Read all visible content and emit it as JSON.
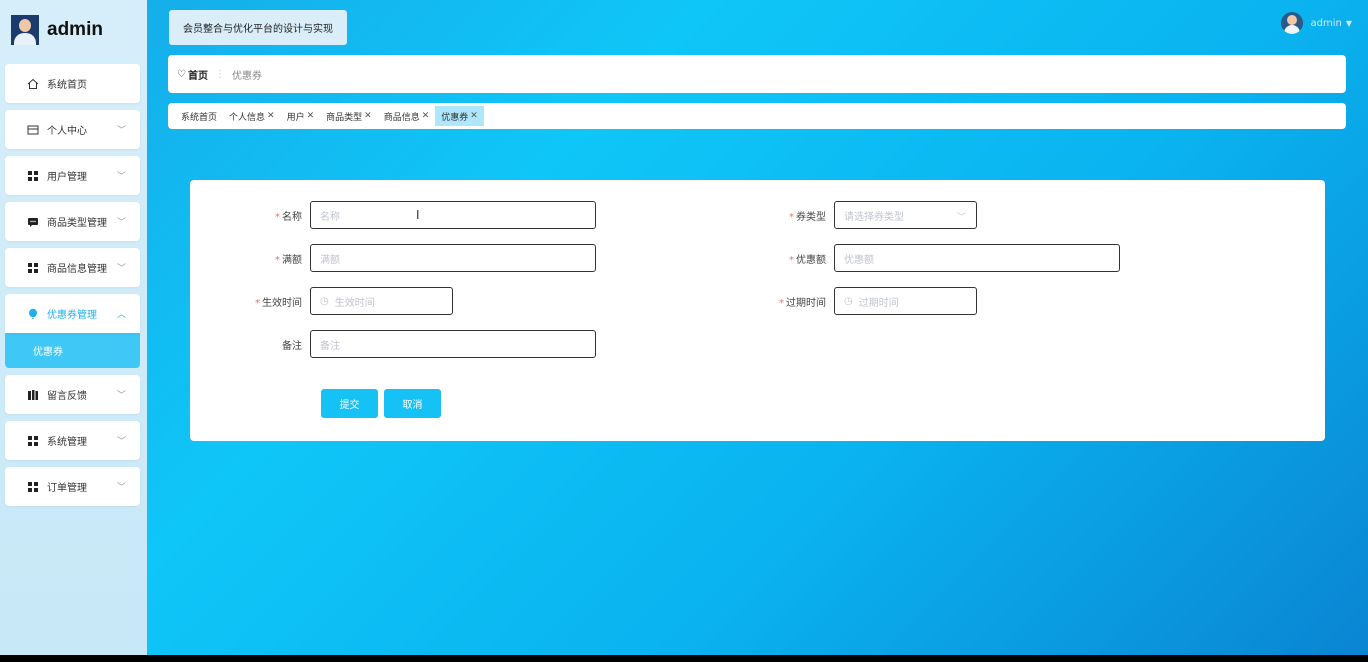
{
  "brand": {
    "name": "admin"
  },
  "sidebar": {
    "items": [
      {
        "label": "系统首页",
        "icon": "home-icon"
      },
      {
        "label": "个人中心",
        "icon": "card-icon"
      },
      {
        "label": "用户管理",
        "icon": "grid-icon"
      },
      {
        "label": "商品类型管理",
        "icon": "chat-icon"
      },
      {
        "label": "商品信息管理",
        "icon": "grid-icon"
      },
      {
        "label": "优惠券管理",
        "icon": "balloon-icon"
      },
      {
        "label": "留言反馈",
        "icon": "book-icon"
      },
      {
        "label": "系统管理",
        "icon": "grid-icon"
      },
      {
        "label": "订单管理",
        "icon": "grid-icon"
      }
    ],
    "submenu": {
      "label": "优惠券"
    }
  },
  "header": {
    "site_title": "会员整合与优化平台的设计与实现",
    "user_name": "admin"
  },
  "breadcrumb": {
    "home": "首页",
    "current": "优惠券"
  },
  "tags": [
    {
      "label": "系统首页",
      "closable": false
    },
    {
      "label": "个人信息",
      "closable": true
    },
    {
      "label": "用户",
      "closable": true
    },
    {
      "label": "商品类型",
      "closable": true
    },
    {
      "label": "商品信息",
      "closable": true
    },
    {
      "label": "优惠券",
      "closable": true,
      "active": true
    }
  ],
  "form": {
    "name": {
      "label": "名称",
      "placeholder": "名称",
      "required": true
    },
    "coupon_type": {
      "label": "券类型",
      "placeholder": "请选择券类型",
      "required": true
    },
    "full_amount": {
      "label": "满额",
      "placeholder": "满额",
      "required": true
    },
    "discount_amount": {
      "label": "优惠额",
      "placeholder": "优惠额",
      "required": true
    },
    "effective_time": {
      "label": "生效时间",
      "placeholder": "生效时间",
      "required": true
    },
    "expire_time": {
      "label": "过期时间",
      "placeholder": "过期时间",
      "required": true
    },
    "remark": {
      "label": "备注",
      "placeholder": "备注",
      "required": false
    },
    "submit_label": "提交",
    "cancel_label": "取消"
  },
  "colors": {
    "accent": "#16c2f5",
    "required": "#f56c6c",
    "active_menu_text": "#20b0ee"
  }
}
